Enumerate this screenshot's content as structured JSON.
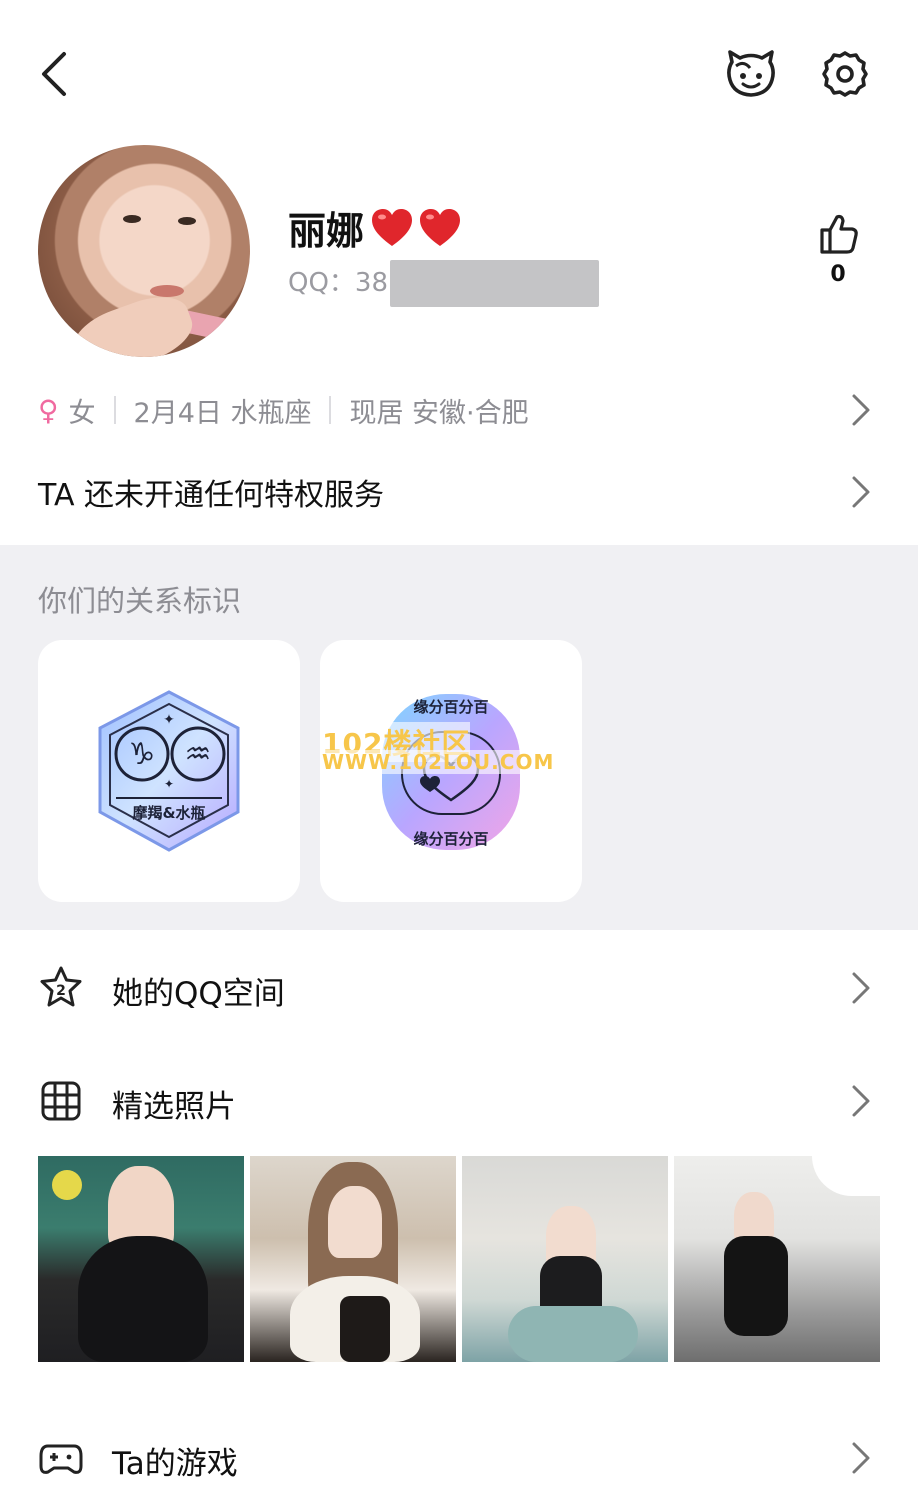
{
  "profile": {
    "nickname": "丽娜",
    "qq_label": "QQ：38",
    "like_count": "0"
  },
  "info": {
    "gender_symbol": "♀",
    "gender": "女",
    "birthday": "2月4日 水瓶座",
    "location": "现居 安徽·合肥"
  },
  "privilege_text": "TA 还未开通任何特权服务",
  "relationship": {
    "title": "你们的关系标识",
    "badge1_label": "摩羯&水瓶",
    "badge2_label_top": "缘分百分百",
    "badge2_label_bottom": "缘分百分百"
  },
  "watermark": {
    "line1": "102楼社区",
    "line2": "WWW.102LOU.COM"
  },
  "menu": {
    "qzone": "她的QQ空间",
    "photos": "精选照片",
    "games": "Ta的游戏"
  },
  "colors": {
    "accent_pink": "#f06aa0",
    "heart_red": "#e0262c",
    "section_gray": "#f0f0f3",
    "watermark_yellow": "#f7c64a"
  },
  "icons": [
    "back-icon",
    "pet-icon",
    "gear-icon",
    "thumbs-up-icon",
    "star-icon",
    "grid-icon",
    "gamepad-icon",
    "chevron-right-icon"
  ]
}
